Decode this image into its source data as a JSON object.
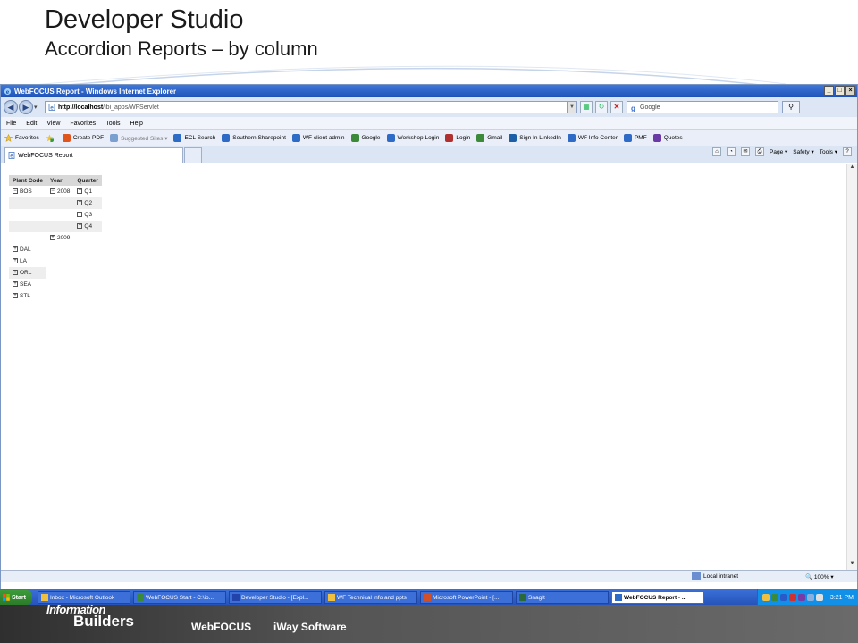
{
  "slide": {
    "title": "Developer  Studio",
    "subtitle": "Accordion Reports – by column"
  },
  "window": {
    "title": "WebFOCUS Report - Windows Internet Explorer",
    "minimize": "_",
    "maximize": "□",
    "close": "×"
  },
  "addressbar": {
    "url_host": "http://localhost",
    "url_path": "/ibi_apps/WFServlet",
    "search_placeholder": "Google"
  },
  "menu": [
    "File",
    "Edit",
    "View",
    "Favorites",
    "Tools",
    "Help"
  ],
  "favorites": {
    "label": "Favorites",
    "items": [
      {
        "label": "Create PDF",
        "color": "#e0551c"
      },
      {
        "label": "Suggested Sites ▾",
        "color": "#7aa0d0",
        "muted": true
      },
      {
        "label": "ECL Search",
        "color": "#2e6bc6"
      },
      {
        "label": "Southern Sharepoint",
        "color": "#2e6bc6"
      },
      {
        "label": "WF client admin",
        "color": "#2e6bc6"
      },
      {
        "label": "Google",
        "color": "#3a8a3a"
      },
      {
        "label": "Workshop Login",
        "color": "#2e6bc6"
      },
      {
        "label": "Login",
        "color": "#b03030"
      },
      {
        "label": "Gmail",
        "color": "#3a8a3a"
      },
      {
        "label": "Sign In LinkedIn",
        "color": "#1d5fa6"
      },
      {
        "label": "WF Info Center",
        "color": "#2e6bc6"
      },
      {
        "label": "PMF",
        "color": "#2e6bc6"
      },
      {
        "label": "Quotes",
        "color": "#6a3aa6"
      }
    ]
  },
  "tab": {
    "label": "WebFOCUS Report"
  },
  "commands": [
    "Page ▾",
    "Safety ▾",
    "Tools ▾"
  ],
  "report": {
    "headers": [
      "Plant Code",
      "Year",
      "Quarter"
    ],
    "rows": [
      {
        "plant": "BOS",
        "plant_sym": "−",
        "year": "2008",
        "year_sym": "−",
        "quarter": "Q1",
        "q_sym": "+",
        "shade": false
      },
      {
        "plant": "",
        "year": "",
        "quarter": "Q2",
        "q_sym": "+",
        "shade": true
      },
      {
        "plant": "",
        "year": "",
        "quarter": "Q3",
        "q_sym": "+",
        "shade": false
      },
      {
        "plant": "",
        "year": "",
        "quarter": "Q4",
        "q_sym": "+",
        "shade": true
      },
      {
        "plant": "",
        "year": "2009",
        "year_sym": "+",
        "quarter": "",
        "shade": false
      },
      {
        "plant": "DAL",
        "plant_sym": "+",
        "year": "",
        "quarter": "",
        "shade": false
      },
      {
        "plant": "LA",
        "plant_sym": "+",
        "year": "",
        "quarter": "",
        "shade": false
      },
      {
        "plant": "ORL",
        "plant_sym": "+",
        "year": "",
        "quarter": "",
        "shade": true
      },
      {
        "plant": "SEA",
        "plant_sym": "+",
        "year": "",
        "quarter": "",
        "shade": false
      },
      {
        "plant": "STL",
        "plant_sym": "+",
        "year": "",
        "quarter": "",
        "shade": false
      }
    ]
  },
  "statusbar": {
    "zone": "Local intranet",
    "zoom": "100%"
  },
  "taskbar": {
    "start": "Start",
    "tasks": [
      {
        "label": "Inbox - Microsoft Outlook",
        "color": "#f0c040",
        "width": 104
      },
      {
        "label": "WebFOCUS Start - C:\\ib...",
        "color": "#3a8a3a",
        "width": 104
      },
      {
        "label": "Developer Studio - [Expl...",
        "color": "#2244aa",
        "width": 104
      },
      {
        "label": "WF Technical info and ppts",
        "color": "#f0c040",
        "width": 104
      },
      {
        "label": "Microsoft PowerPoint - [...",
        "color": "#d0502a",
        "width": 104
      },
      {
        "label": "SnagIt",
        "color": "#2a6a3a",
        "width": 104
      },
      {
        "label": "WebFOCUS Report - ...",
        "color": "#2e6bc6",
        "width": 104,
        "active": true
      }
    ],
    "clock": "3:21 PM"
  },
  "footer": {
    "brand_top": "Information",
    "brand": "Builders",
    "product1": "WebFOCUS",
    "product2": "iWay Software"
  }
}
